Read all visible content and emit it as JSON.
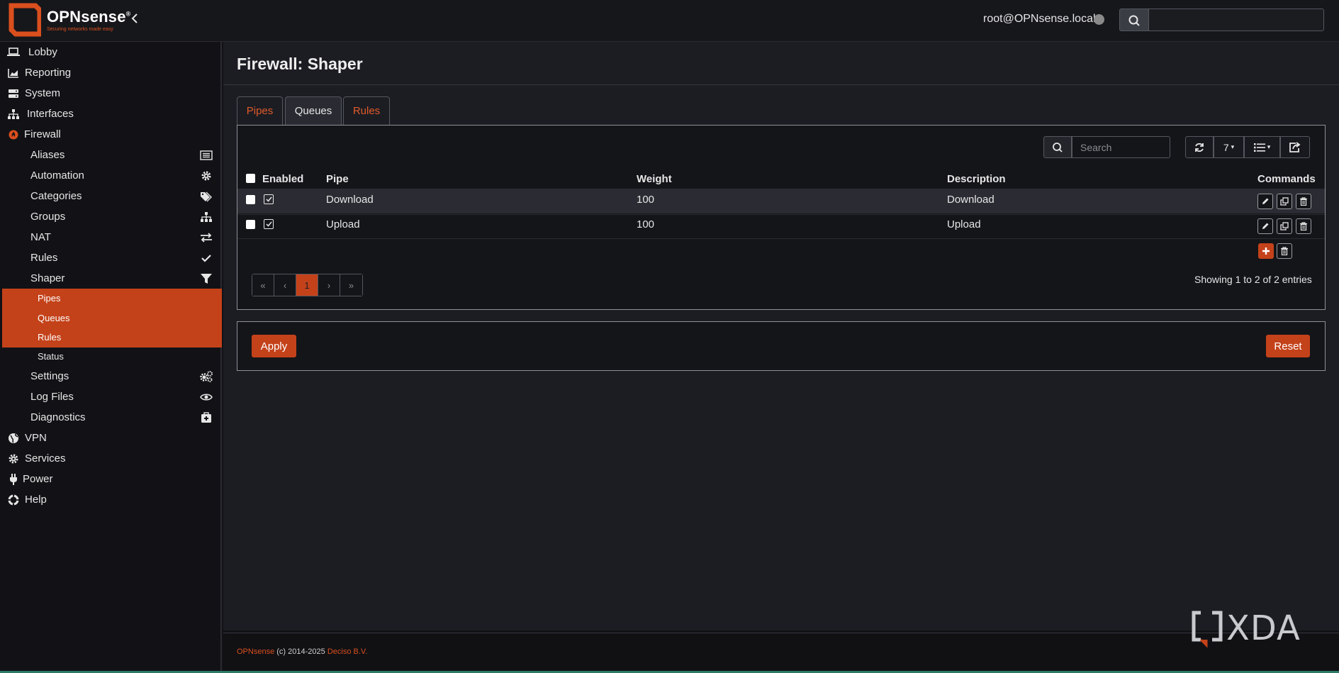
{
  "app": {
    "logo_name": "OPNsense",
    "logo_registered": "®",
    "logo_tagline": "Securing networks made easy",
    "user": "root@OPNsense.local",
    "top_search_placeholder": ""
  },
  "sidebar": {
    "items": [
      {
        "label": "Lobby",
        "icon": "laptop-icon"
      },
      {
        "label": "Reporting",
        "icon": "area-chart-icon"
      },
      {
        "label": "System",
        "icon": "server-icon"
      },
      {
        "label": "Interfaces",
        "icon": "sitemap-icon"
      },
      {
        "label": "Firewall",
        "icon": "fire-icon"
      },
      {
        "label": "VPN",
        "icon": "globe-icon"
      },
      {
        "label": "Services",
        "icon": "cog-icon"
      },
      {
        "label": "Power",
        "icon": "plug-icon"
      },
      {
        "label": "Help",
        "icon": "life-ring-icon"
      }
    ],
    "firewall_sub": [
      {
        "label": "Aliases",
        "icon": "list-alt-icon"
      },
      {
        "label": "Automation",
        "icon": "gear-icon"
      },
      {
        "label": "Categories",
        "icon": "tags-icon"
      },
      {
        "label": "Groups",
        "icon": "sitemap-icon"
      },
      {
        "label": "NAT",
        "icon": "exchange-icon"
      },
      {
        "label": "Rules",
        "icon": "check-icon"
      },
      {
        "label": "Shaper",
        "icon": "filter-icon"
      },
      {
        "label": "Settings",
        "icon": "cogs-icon"
      },
      {
        "label": "Log Files",
        "icon": "eye-icon"
      },
      {
        "label": "Diagnostics",
        "icon": "medkit-icon"
      }
    ],
    "shaper_sub": [
      {
        "label": "Pipes"
      },
      {
        "label": "Queues"
      },
      {
        "label": "Rules"
      },
      {
        "label": "Status"
      }
    ]
  },
  "page": {
    "title": "Firewall: Shaper",
    "tabs": [
      {
        "label": "Pipes"
      },
      {
        "label": "Queues"
      },
      {
        "label": "Rules"
      }
    ]
  },
  "grid": {
    "search_placeholder": "Search",
    "page_size": "7",
    "columns": [
      "Enabled",
      "Pipe",
      "Weight",
      "Description",
      "Commands"
    ],
    "rows": [
      {
        "enabled": true,
        "pipe": "Download",
        "weight": "100",
        "description": "Download"
      },
      {
        "enabled": true,
        "pipe": "Upload",
        "weight": "100",
        "description": "Upload"
      }
    ],
    "pager": [
      "«",
      "‹",
      "1",
      "›",
      "»"
    ],
    "current_page": "1",
    "showing": "Showing 1 to 2 of 2 entries"
  },
  "actions": {
    "apply": "Apply",
    "reset": "Reset"
  },
  "footer": {
    "brand": "OPNsense",
    "copyright": " (c) 2014-2025 ",
    "company": "Deciso B.V."
  },
  "watermark": {
    "text": "XDA"
  },
  "colors": {
    "accent": "#c4421a",
    "link": "#e05a2a",
    "background": "#1c1d23",
    "sidebar": "#121216"
  }
}
